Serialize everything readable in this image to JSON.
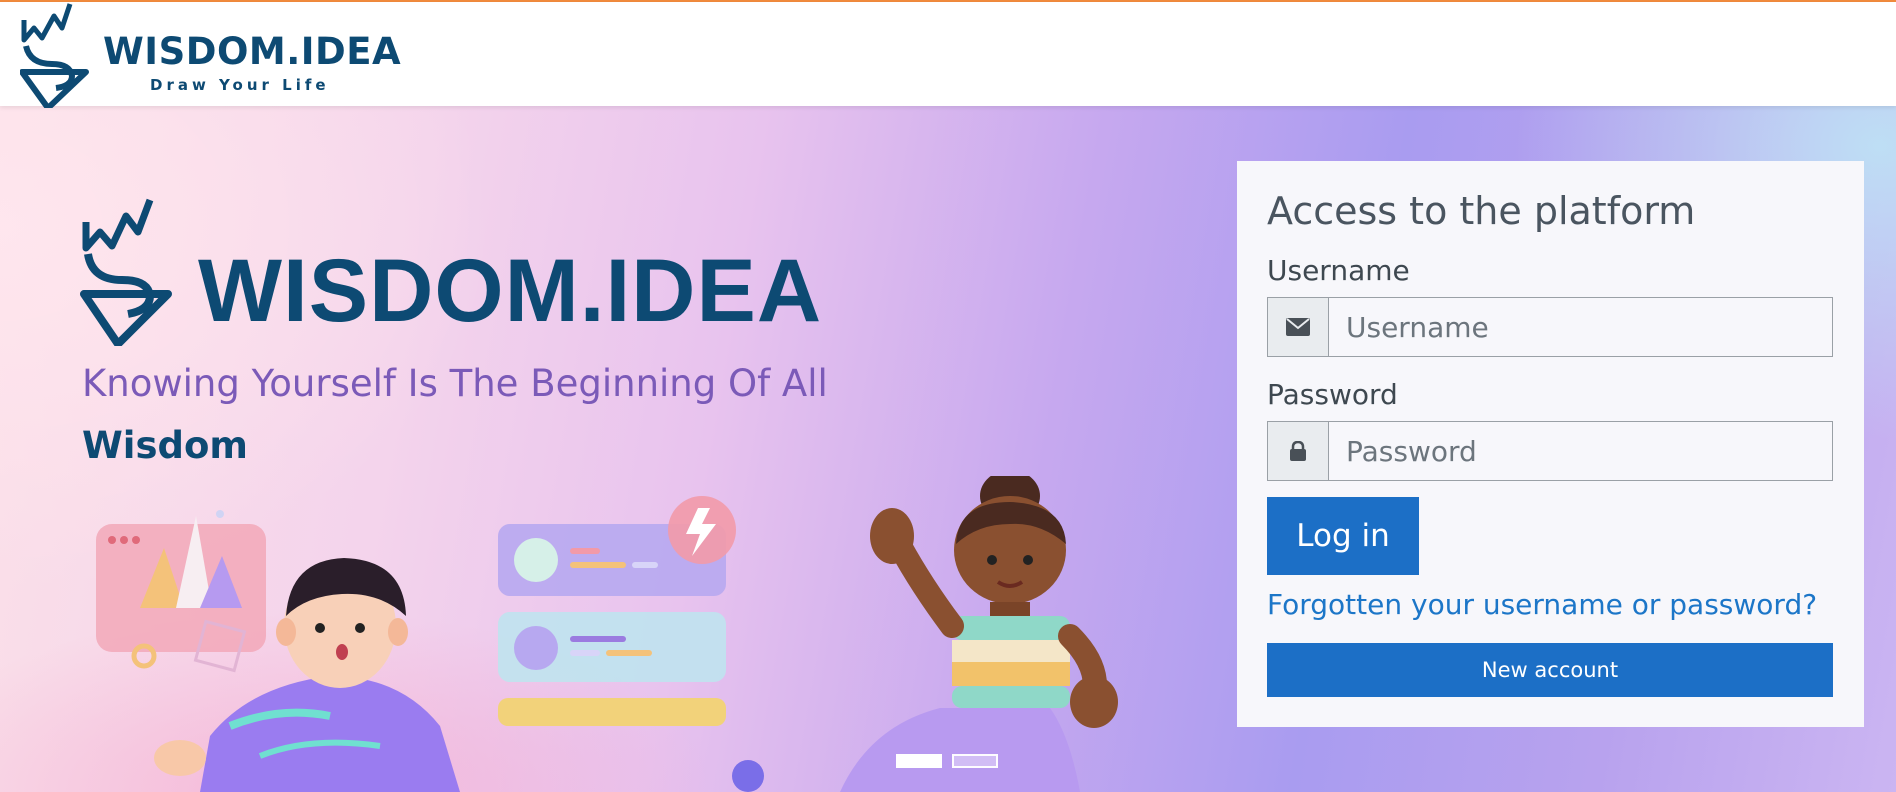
{
  "header": {
    "brand": "WISDOM.IDEA",
    "tagline": "Draw Your Life"
  },
  "hero": {
    "brand": "WISDOM.IDEA",
    "slogan_line1": "Knowing Yourself Is The Beginning Of All",
    "slogan_line2": "Wisdom",
    "slides": {
      "count": 2,
      "active_index": 1
    }
  },
  "login": {
    "title": "Access to the platform",
    "username_label": "Username",
    "username_placeholder": "Username",
    "username_icon": "envelope-icon",
    "password_label": "Password",
    "password_placeholder": "Password",
    "password_icon": "lock-icon",
    "login_button": "Log in",
    "forgot_link": "Forgotten your username or password?",
    "new_account_button": "New account"
  },
  "colors": {
    "brand_navy": "#0d4a73",
    "primary_blue": "#1c6fc6",
    "link_blue": "#1c76c8",
    "header_accent": "#f08a3c",
    "slogan_purple": "#7b5ab8"
  }
}
